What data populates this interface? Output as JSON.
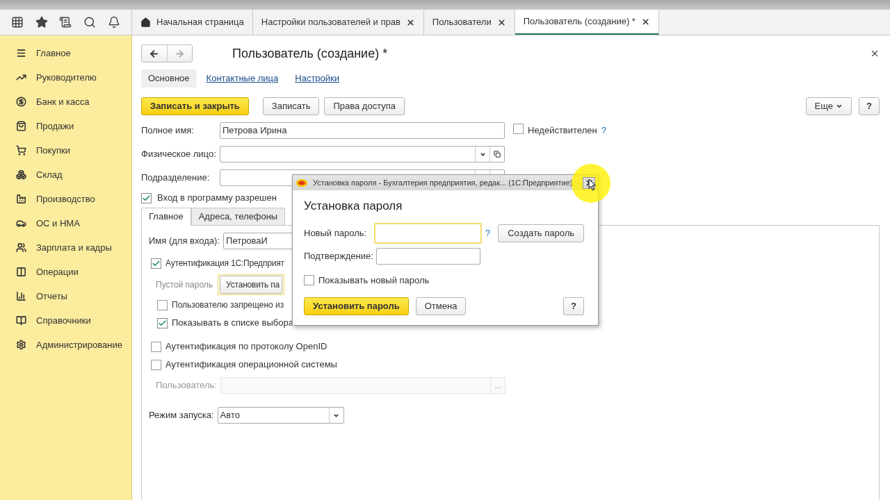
{
  "tabs": [
    {
      "label": "Начальная страница",
      "kind": "home",
      "selected": false
    },
    {
      "label": "Настройки пользователей и прав",
      "kind": "closable",
      "selected": false
    },
    {
      "label": "Пользователи",
      "kind": "closable",
      "selected": false
    },
    {
      "label": "Пользователь (создание) *",
      "kind": "closable",
      "selected": true
    }
  ],
  "sidebar": {
    "items": [
      {
        "label": "Главное"
      },
      {
        "label": "Руководителю"
      },
      {
        "label": "Банк и касса"
      },
      {
        "label": "Продажи"
      },
      {
        "label": "Покупки"
      },
      {
        "label": "Склад"
      },
      {
        "label": "Производство"
      },
      {
        "label": "ОС и НМА"
      },
      {
        "label": "Зарплата и кадры"
      },
      {
        "label": "Операции"
      },
      {
        "label": "Отчеты"
      },
      {
        "label": "Справочники"
      },
      {
        "label": "Администрирование"
      }
    ]
  },
  "form": {
    "title": "Пользователь (создание) *",
    "sections": [
      {
        "label": "Основное",
        "selected": true
      },
      {
        "label": "Контактные лица",
        "selected": false
      },
      {
        "label": "Настройки",
        "selected": false
      }
    ],
    "buttons": [
      {
        "label": "Записать и закрыть",
        "kind": "primary"
      },
      {
        "label": "Записать",
        "kind": "default"
      },
      {
        "label": "Права доступа",
        "kind": "default"
      }
    ],
    "more_button": "Еще",
    "help_button": "?",
    "full_name": {
      "label": "Полное имя:",
      "value": "Петрова Ирина"
    },
    "invalid": {
      "label": "Недействителен",
      "checked": false,
      "help": "?"
    },
    "person": {
      "label": "Физическое лицо:"
    },
    "department": {
      "label": "Подразделение:"
    },
    "login_allowed": {
      "label": "Вход в программу разрешен",
      "checked": true
    },
    "inner_tabs": [
      {
        "label": "Главное",
        "selected": true
      },
      {
        "label": "Адреса, телефоны",
        "selected": false
      }
    ],
    "login_name": {
      "label": "Имя (для входа):",
      "value": "ПетроваИ"
    },
    "auth_1c": {
      "label": "Аутентификация 1С:Предприят",
      "checked": true
    },
    "empty_password": "Пустой пароль",
    "set_password_button": "Установить па",
    "deny_change": {
      "label": "Пользователю запрещено из",
      "checked": false
    },
    "show_in_list": {
      "label": "Показывать в списке выбора",
      "checked": true
    },
    "openid": {
      "label": "Аутентификация по протоколу OpenID",
      "checked": false
    },
    "os_auth": {
      "label": "Аутентификация операционной системы",
      "checked": false
    },
    "os_user": {
      "label": "Пользователь:",
      "disabled": true,
      "button": "..."
    },
    "launch_mode": {
      "label": "Режим запуска:",
      "value": "Авто"
    }
  },
  "dialog": {
    "window_title": "Установка пароля - Бухгалтерия предприятия, редак... (1С:Предприятие)",
    "heading": "Установка пароля",
    "new_password": {
      "label": "Новый пароль:",
      "help": "?"
    },
    "generate_button": "Создать пароль",
    "confirm": {
      "label": "Подтверждение:"
    },
    "show_password": {
      "label": "Показывать новый пароль",
      "checked": false
    },
    "buttons": [
      {
        "label": "Установить пароль",
        "kind": "primary"
      },
      {
        "label": "Отмена",
        "kind": "default"
      }
    ],
    "help_button": "?"
  }
}
